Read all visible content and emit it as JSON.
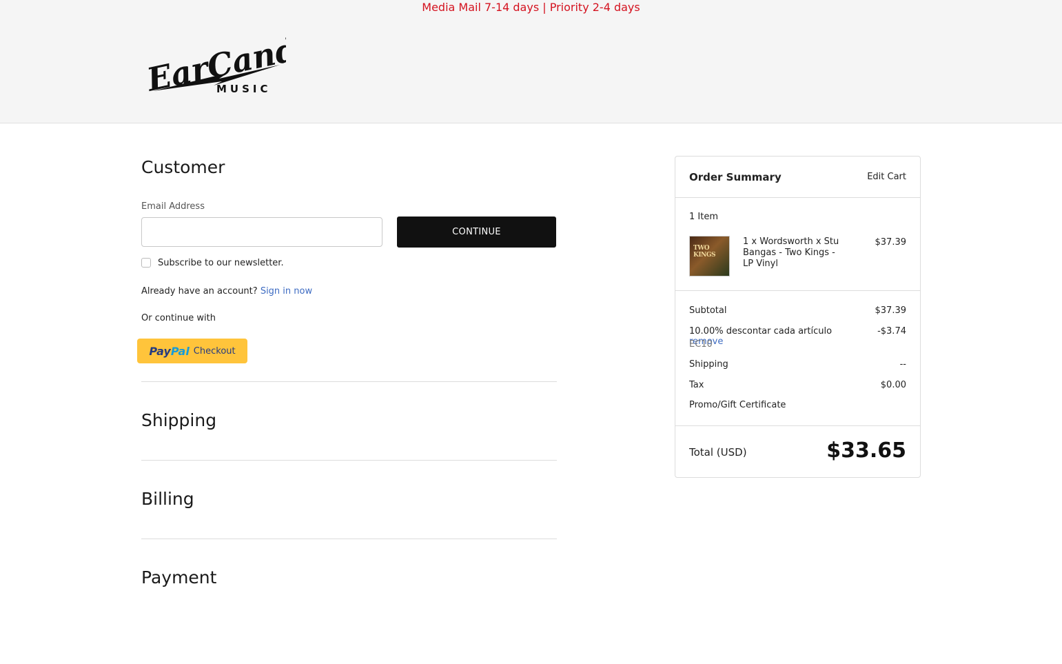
{
  "banner": "Media Mail 7-14 days | Priority 2-4 days",
  "logo": {
    "wordmark": "EarCandy",
    "sub": "MUSIC"
  },
  "customer": {
    "title": "Customer",
    "email_label": "Email Address",
    "email_value": "",
    "continue_label": "CONTINUE",
    "newsletter_label": "Subscribe to our newsletter.",
    "account_prompt": "Already have an account?",
    "sign_in_label": "Sign in now",
    "or_continue": "Or continue with",
    "paypal_pay": "Pay",
    "paypal_pal": "Pal",
    "paypal_checkout": "Checkout"
  },
  "sections": {
    "shipping": "Shipping",
    "billing": "Billing",
    "payment": "Payment"
  },
  "summary": {
    "title": "Order Summary",
    "edit_cart": "Edit Cart",
    "item_count": "1 Item",
    "item": {
      "name": "1 x Wordsworth x Stu Bangas - Two Kings - LP Vinyl",
      "price": "$37.39",
      "cover_text": "TWO KINGS"
    },
    "subtotal_label": "Subtotal",
    "subtotal": "$37.39",
    "discount_label": "10.00% descontar cada artículo",
    "discount_remove": "remove",
    "discount_code": "EC10",
    "discount_value": "-$3.74",
    "shipping_label": "Shipping",
    "shipping_value": "--",
    "tax_label": "Tax",
    "tax_value": "$0.00",
    "promo_label": "Promo/Gift Certificate",
    "total_label": "Total (USD)",
    "total_value": "$33.65"
  },
  "colors": {
    "banner": "#d4121f",
    "link": "#3d6bc2",
    "paypal": "#ffc43b",
    "button": "#111111"
  }
}
